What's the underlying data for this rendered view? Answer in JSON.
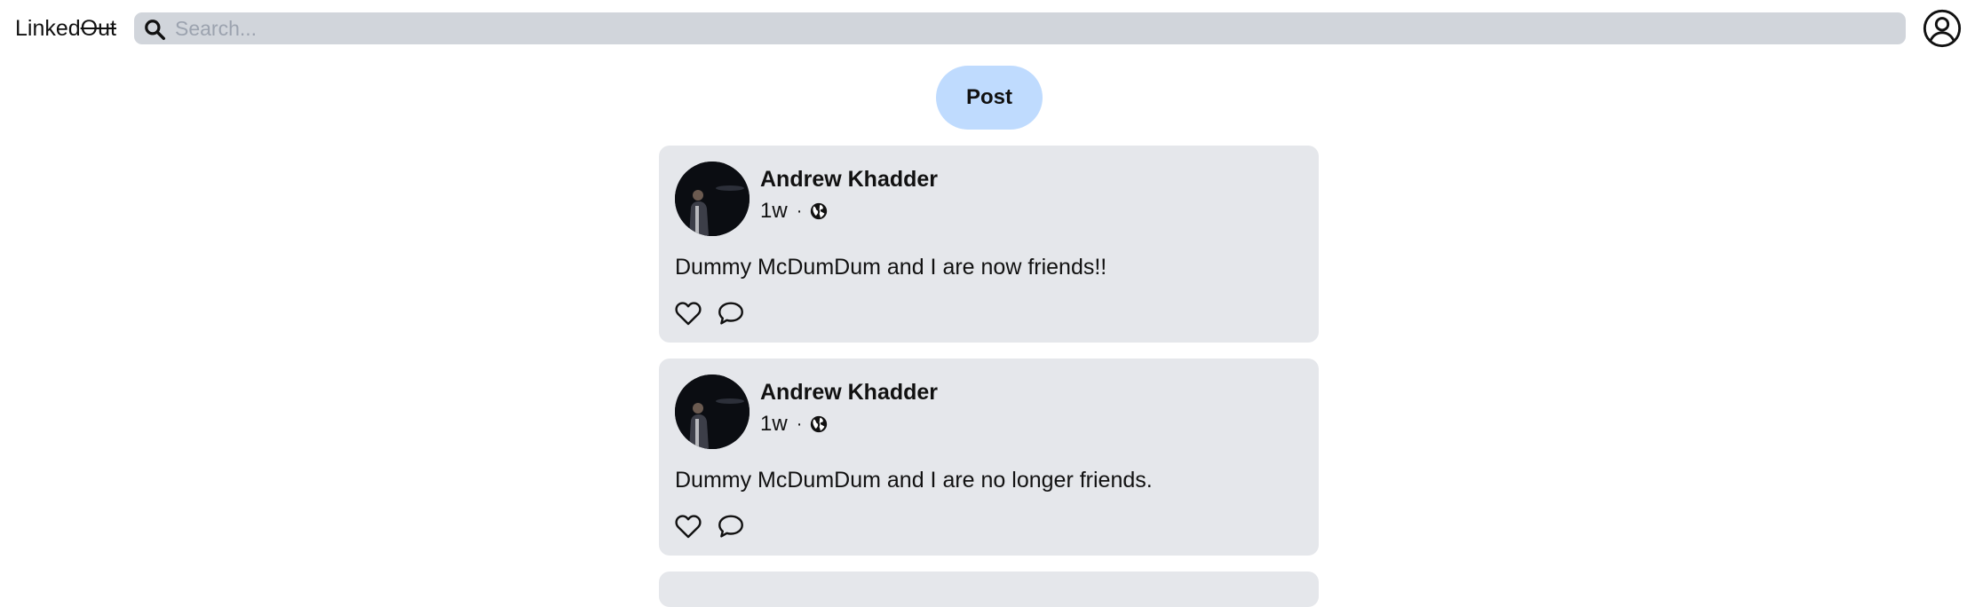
{
  "header": {
    "logo_prefix": "Linked",
    "logo_strike": "Out",
    "search_placeholder": "Search...",
    "search_value": ""
  },
  "compose": {
    "post_label": "Post"
  },
  "feed": {
    "posts": [
      {
        "author": "Andrew Khadder",
        "time": "1w",
        "separator": "·",
        "visibility_icon": "globe-icon",
        "content": "Dummy McDumDum and I are now friends!!"
      },
      {
        "author": "Andrew Khadder",
        "time": "1w",
        "separator": "·",
        "visibility_icon": "globe-icon",
        "content": "Dummy McDumDum and I are no longer friends."
      }
    ]
  },
  "colors": {
    "search_bg": "#d1d5db",
    "post_button_bg": "#bfdbfe",
    "card_bg": "#e5e7eb"
  }
}
